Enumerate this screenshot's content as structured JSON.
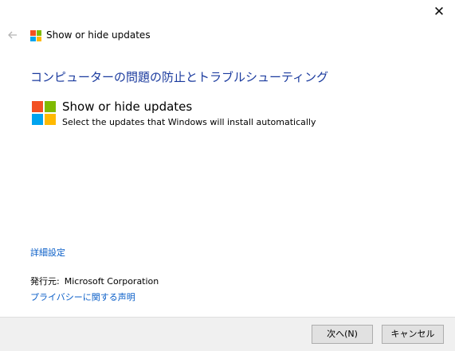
{
  "window": {
    "title": "Show or hide updates",
    "close_glyph": "✕"
  },
  "icons": {
    "back": "back-arrow-icon",
    "logo": "windows-logo-icon",
    "logo_colors": [
      "#f25022",
      "#7fba00",
      "#00a4ef",
      "#ffb900"
    ]
  },
  "main": {
    "heading": "コンピューターの問題の防止とトラブルシューティング",
    "option_title": "Show or hide updates",
    "option_desc": "Select the updates that Windows will install automatically",
    "advanced_link": "詳細設定",
    "publisher_label": "発行元:",
    "publisher_value": "Microsoft Corporation",
    "privacy_link": "プライバシーに関する声明"
  },
  "footer": {
    "next_label": "次へ(N)",
    "cancel_label": "キャンセル"
  },
  "colors": {
    "heading": "#1a3a9e",
    "link": "#0b5fc8",
    "footer_bg": "#f0f0f0"
  }
}
